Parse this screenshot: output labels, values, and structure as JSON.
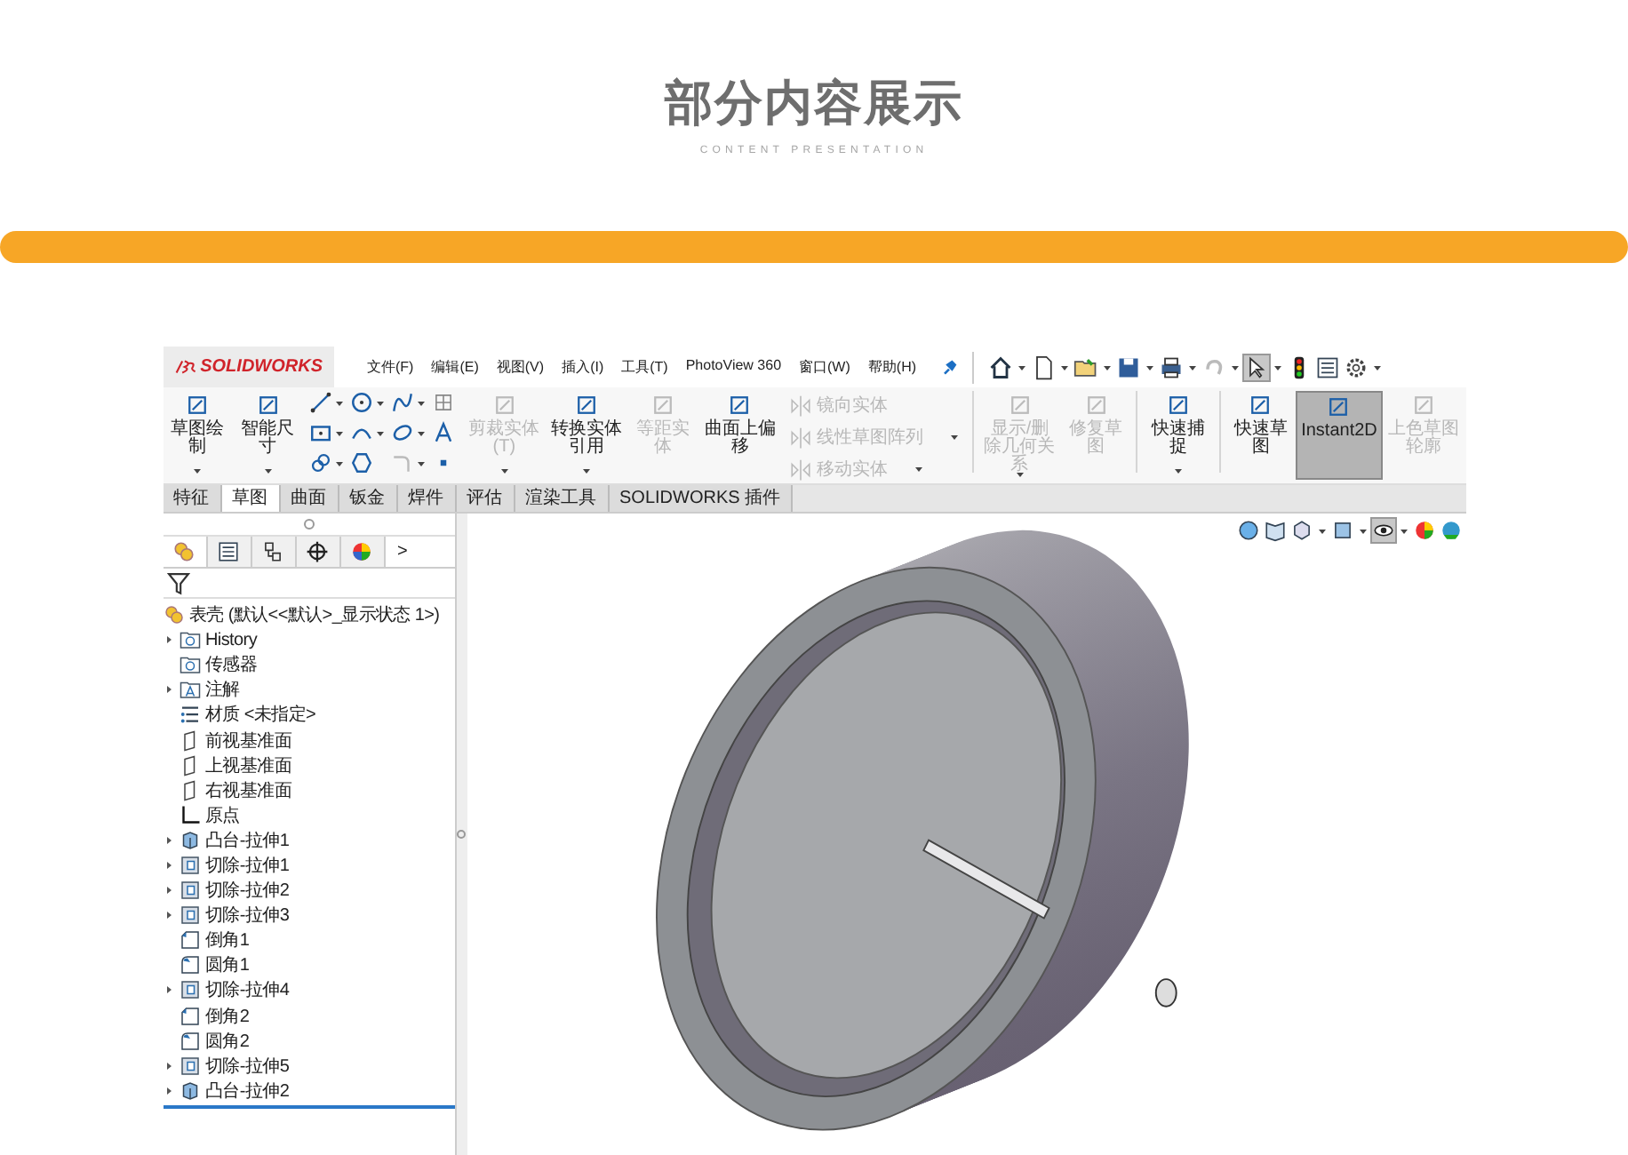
{
  "header": {
    "title": "部分内容展示",
    "subtitle": "CONTENT PRESENTATION"
  },
  "app": {
    "logo": "SOLIDWORKS",
    "menu": [
      "文件(F)",
      "编辑(E)",
      "视图(V)",
      "插入(I)",
      "工具(T)",
      "PhotoView 360",
      "窗口(W)",
      "帮助(H)"
    ],
    "ribbon": [
      {
        "kind": "big",
        "label": "草图绘制",
        "disabled": false,
        "dropdown": true,
        "selected": false
      },
      {
        "kind": "big",
        "label": "智能尺寸",
        "disabled": false,
        "dropdown": true,
        "selected": false
      },
      {
        "kind": "grid"
      },
      {
        "kind": "big",
        "label": "剪裁实体(T)",
        "disabled": true,
        "dropdown": true,
        "selected": false
      },
      {
        "kind": "big",
        "label": "转换实体引用",
        "disabled": false,
        "dropdown": true,
        "selected": false
      },
      {
        "kind": "big",
        "label": "等距实体",
        "disabled": true,
        "dropdown": false,
        "selected": false
      },
      {
        "kind": "big",
        "label": "曲面上偏移",
        "disabled": false,
        "dropdown": false,
        "selected": false
      },
      {
        "kind": "list",
        "items": [
          {
            "label": "镜向实体",
            "disabled": true
          },
          {
            "label": "线性草图阵列",
            "disabled": true
          },
          {
            "label": "移动实体",
            "disabled": true
          }
        ]
      },
      {
        "kind": "sep"
      },
      {
        "kind": "big",
        "label": "显示/删除几何关系",
        "disabled": true,
        "dropdown": true,
        "selected": false
      },
      {
        "kind": "big",
        "label": "修复草图",
        "disabled": true,
        "dropdown": false,
        "selected": false
      },
      {
        "kind": "sep"
      },
      {
        "kind": "big",
        "label": "快速捕捉",
        "disabled": false,
        "dropdown": true,
        "selected": false
      },
      {
        "kind": "sep"
      },
      {
        "kind": "big",
        "label": "快速草图",
        "disabled": false,
        "dropdown": false,
        "selected": false
      },
      {
        "kind": "big",
        "label": "Instant2D",
        "disabled": false,
        "dropdown": false,
        "selected": true
      },
      {
        "kind": "big",
        "label": "上色草图轮廓",
        "disabled": true,
        "dropdown": false,
        "selected": false
      }
    ],
    "tabs": [
      {
        "label": "特征",
        "selected": false
      },
      {
        "label": "草图",
        "selected": true
      },
      {
        "label": "曲面",
        "selected": false
      },
      {
        "label": "钣金",
        "selected": false
      },
      {
        "label": "焊件",
        "selected": false
      },
      {
        "label": "评估",
        "selected": false
      },
      {
        "label": "渲染工具",
        "selected": false
      },
      {
        "label": "SOLIDWORKS 插件",
        "selected": false
      }
    ],
    "panel_tab_more": ">",
    "tree": {
      "label": "表壳 (默认<<默认>_显示状态 1>)",
      "kind": "part",
      "children": [
        {
          "label": "History",
          "kind": "folder",
          "expandable": true
        },
        {
          "label": "传感器",
          "kind": "folder",
          "expandable": false
        },
        {
          "label": "注解",
          "kind": "annotation",
          "expandable": true
        },
        {
          "label": "材质 <未指定>",
          "kind": "material",
          "expandable": false
        },
        {
          "label": "前视基准面",
          "kind": "plane",
          "expandable": false
        },
        {
          "label": "上视基准面",
          "kind": "plane",
          "expandable": false
        },
        {
          "label": "右视基准面",
          "kind": "plane",
          "expandable": false
        },
        {
          "label": "原点",
          "kind": "origin",
          "expandable": false
        },
        {
          "label": "凸台-拉伸1",
          "kind": "boss",
          "expandable": true
        },
        {
          "label": "切除-拉伸1",
          "kind": "cut",
          "expandable": true
        },
        {
          "label": "切除-拉伸2",
          "kind": "cut",
          "expandable": true
        },
        {
          "label": "切除-拉伸3",
          "kind": "cut",
          "expandable": true
        },
        {
          "label": "倒角1",
          "kind": "chamfer",
          "expandable": false
        },
        {
          "label": "圆角1",
          "kind": "fillet",
          "expandable": false
        },
        {
          "label": "切除-拉伸4",
          "kind": "cut",
          "expandable": true
        },
        {
          "label": "倒角2",
          "kind": "chamfer",
          "expandable": false
        },
        {
          "label": "圆角2",
          "kind": "fillet",
          "expandable": false
        },
        {
          "label": "切除-拉伸5",
          "kind": "cut",
          "expandable": true
        },
        {
          "label": "凸台-拉伸2",
          "kind": "boss",
          "expandable": true
        }
      ]
    }
  }
}
